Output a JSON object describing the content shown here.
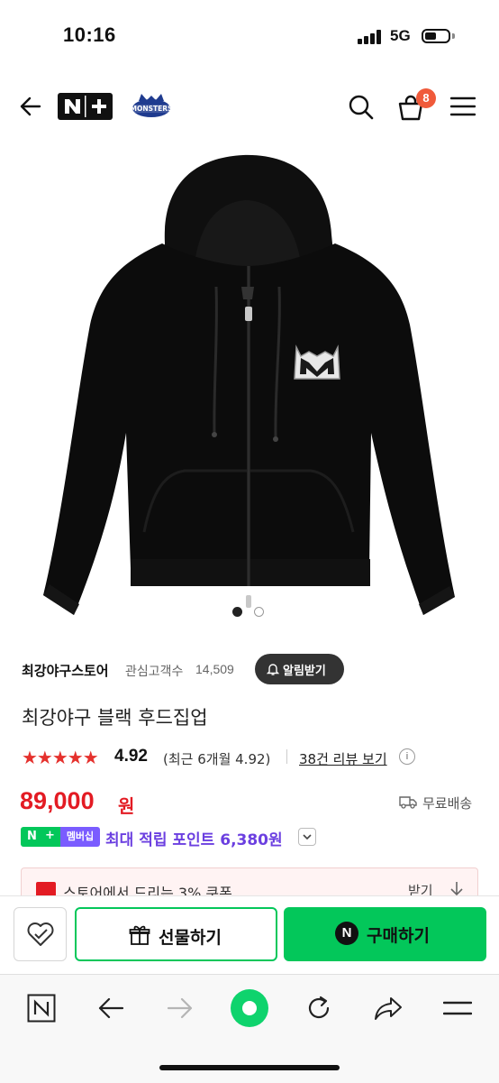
{
  "status_bar": {
    "time": "10:16",
    "network": "5G"
  },
  "header": {
    "brand_logo_text": "N+",
    "team_logo_text": "MONSTERS",
    "cart_count": "8",
    "icons": [
      "back-arrow-icon",
      "search-icon",
      "cart-icon",
      "menu-icon"
    ]
  },
  "gallery": {
    "current_index": 1,
    "total": 2
  },
  "store": {
    "name": "최강야구스토어",
    "followers_label": "관심고객수",
    "followers_count": "14,509",
    "alarm_label": "알림받기"
  },
  "product": {
    "title": "최강야구 블랙 후드집업",
    "stars": "★★★★★",
    "rating": "4.92",
    "recent_rating": "(최근 6개월 4.92)",
    "reviews_link": "38건 리뷰 보기",
    "info_mark": "i",
    "price": "89,000",
    "currency": "원",
    "shipping": "무료배송"
  },
  "membership": {
    "badge_n": "N",
    "badge_plus": "+",
    "badge_label": "멤버십",
    "points_text": "최대 적립 포인트 6,380원"
  },
  "coupon": {
    "text": "스토어에서 드리는 3% 쿠폰",
    "action": "받기"
  },
  "actions": {
    "gift_label": "선물하기",
    "buy_mark": "N",
    "buy_label": "구매하기"
  },
  "colors": {
    "naver_green": "#03c75a",
    "price_red": "#e31b23",
    "star_red": "#e5312d",
    "membership_purple": "#6b3fe0",
    "cart_badge": "#f05a3a"
  }
}
